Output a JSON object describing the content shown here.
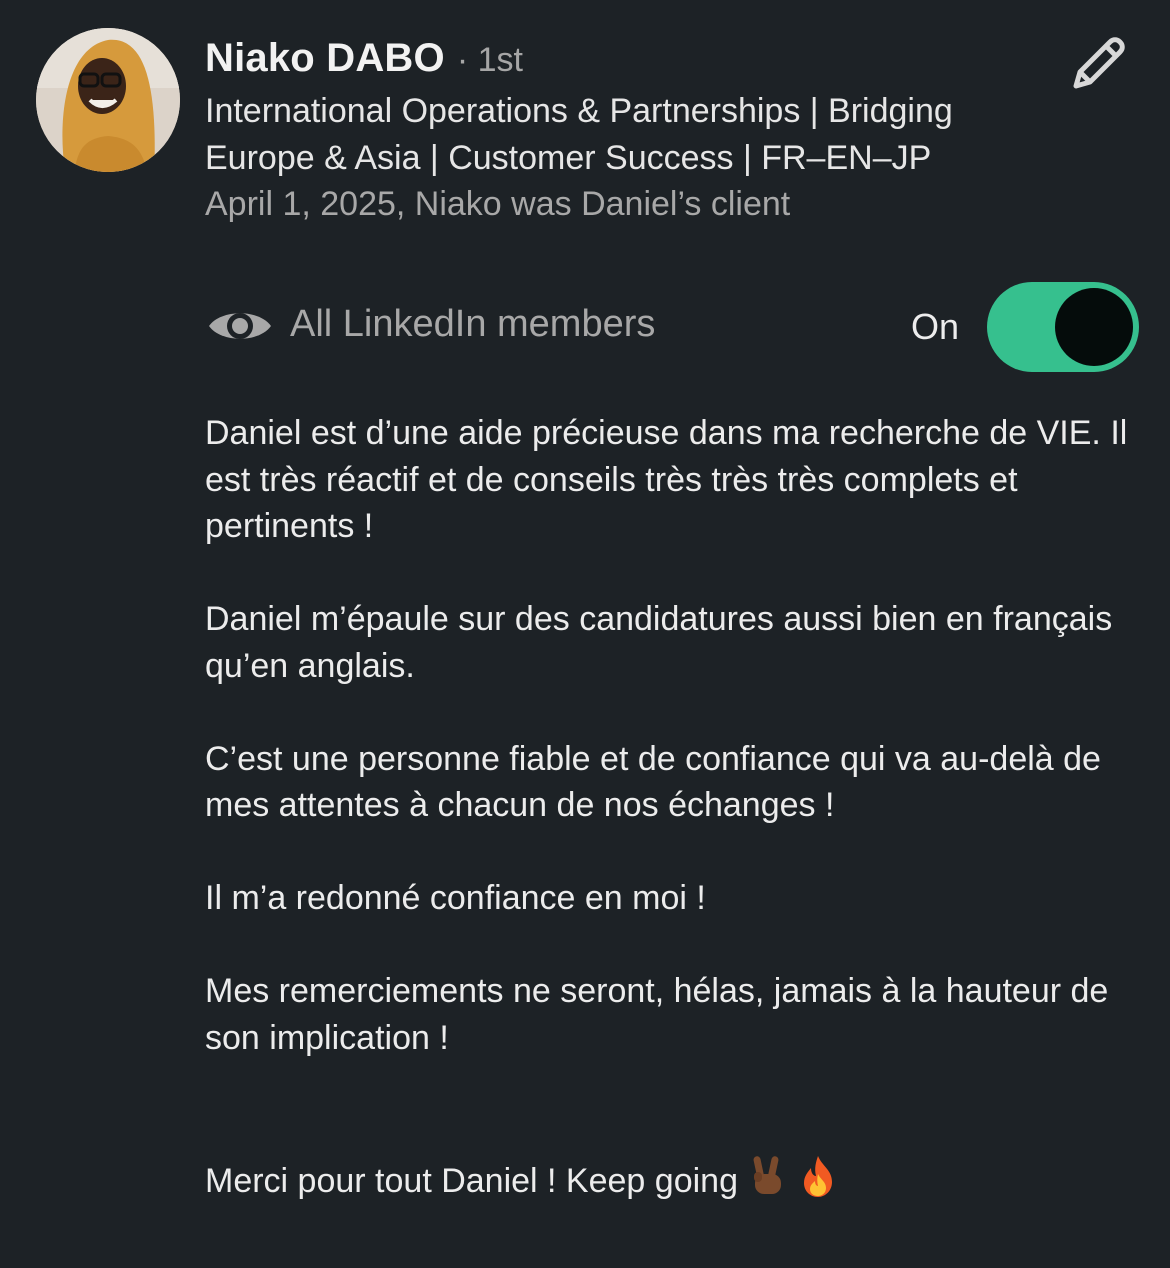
{
  "recommender": {
    "name": "Niako DABO",
    "degree": "· 1st",
    "headline": "International Operations & Partnerships | Bridging Europe & Asia | Customer Success | FR–EN–JP",
    "relationship": "April 1, 2025, Niako was Daniel’s client"
  },
  "visibility": {
    "label": "All LinkedIn members",
    "state": "On",
    "enabled": true,
    "icon": "eye-icon"
  },
  "actions": {
    "edit_icon": "pencil-icon"
  },
  "recommendation": {
    "p1": "Daniel est d’une aide précieuse dans ma recherche de VIE. Il est très réactif et de conseils très très très complets et pertinents !",
    "p2": "Daniel m’épaule sur des candidatures aussi bien en français qu’en anglais.",
    "p3": "C’est une personne fiable et de confiance qui va au-delà de mes attentes à chacun de nos échanges !",
    "p4": "Il m’a redonné confiance en moi !",
    "p5": "Mes remerciements ne seront, hélas, jamais à la hauteur de son implication !",
    "p6": "Merci pour tout Daniel ! Keep going"
  },
  "colors": {
    "background": "#1d2226",
    "toggle_on": "#36c08e",
    "muted_text": "#a8a8a8"
  }
}
